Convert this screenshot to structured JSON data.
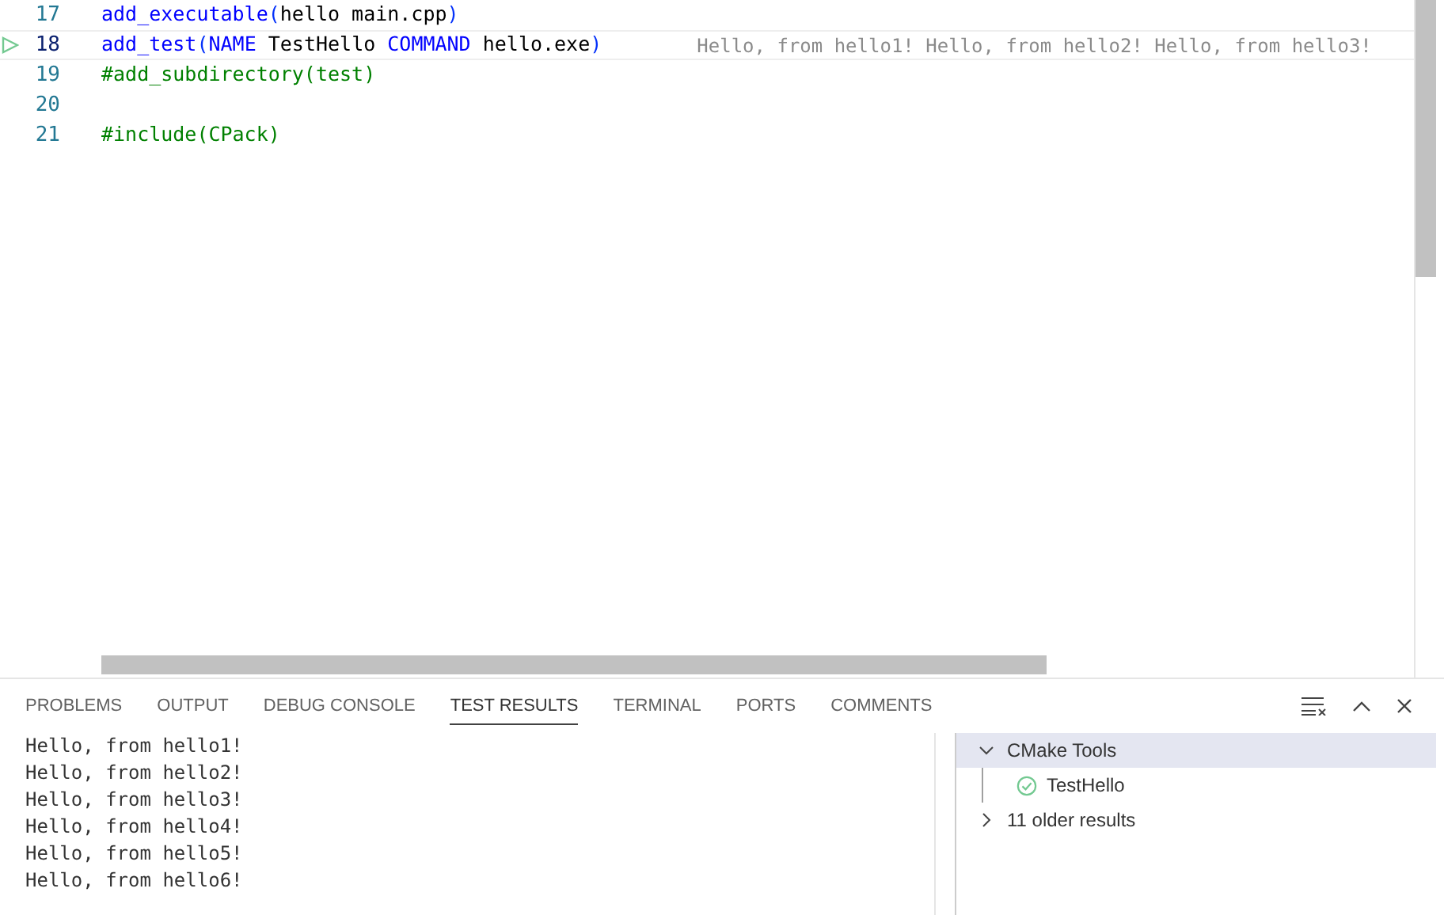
{
  "editor": {
    "lines": [
      {
        "number": "17",
        "current": false,
        "tokens": [
          {
            "text": "add_executable",
            "kind": "function"
          },
          {
            "text": "(",
            "kind": "paren"
          },
          {
            "text": "hello main.cpp",
            "kind": "plain"
          },
          {
            "text": ")",
            "kind": "paren"
          }
        ]
      },
      {
        "number": "18",
        "current": true,
        "test_marker": true,
        "tokens": [
          {
            "text": "add_test",
            "kind": "function"
          },
          {
            "text": "(",
            "kind": "paren"
          },
          {
            "text": "NAME",
            "kind": "keyword"
          },
          {
            "text": " TestHello ",
            "kind": "plain"
          },
          {
            "text": "COMMAND",
            "kind": "keyword"
          },
          {
            "text": " hello.exe",
            "kind": "plain"
          },
          {
            "text": ")",
            "kind": "paren"
          }
        ],
        "inline_output": "Hello, from hello1! Hello, from hello2! Hello, from hello3! "
      },
      {
        "number": "19",
        "current": false,
        "tokens": [
          {
            "text": "#add_subdirectory(test)",
            "kind": "comment"
          }
        ]
      },
      {
        "number": "20",
        "current": false
      },
      {
        "number": "21",
        "current": false,
        "tokens": [
          {
            "text": "#include(CPack)",
            "kind": "comment"
          }
        ]
      }
    ]
  },
  "panel": {
    "tabs": [
      {
        "label": "PROBLEMS",
        "selected": false
      },
      {
        "label": "OUTPUT",
        "selected": false
      },
      {
        "label": "DEBUG CONSOLE",
        "selected": false
      },
      {
        "label": "TEST RESULTS",
        "selected": true
      },
      {
        "label": "TERMINAL",
        "selected": false
      },
      {
        "label": "PORTS",
        "selected": false
      },
      {
        "label": "COMMENTS",
        "selected": false
      }
    ],
    "output": [
      "Hello, from hello1!",
      "Hello, from hello2!",
      "Hello, from hello3!",
      "Hello, from hello4!",
      "Hello, from hello5!",
      "Hello, from hello6!"
    ],
    "results": [
      {
        "label": "CMake Tools",
        "expanded": true,
        "selected": true,
        "children": [
          {
            "label": "TestHello",
            "passed": true
          }
        ]
      },
      {
        "label": "11 older results",
        "expanded": false,
        "selected": false
      }
    ]
  }
}
